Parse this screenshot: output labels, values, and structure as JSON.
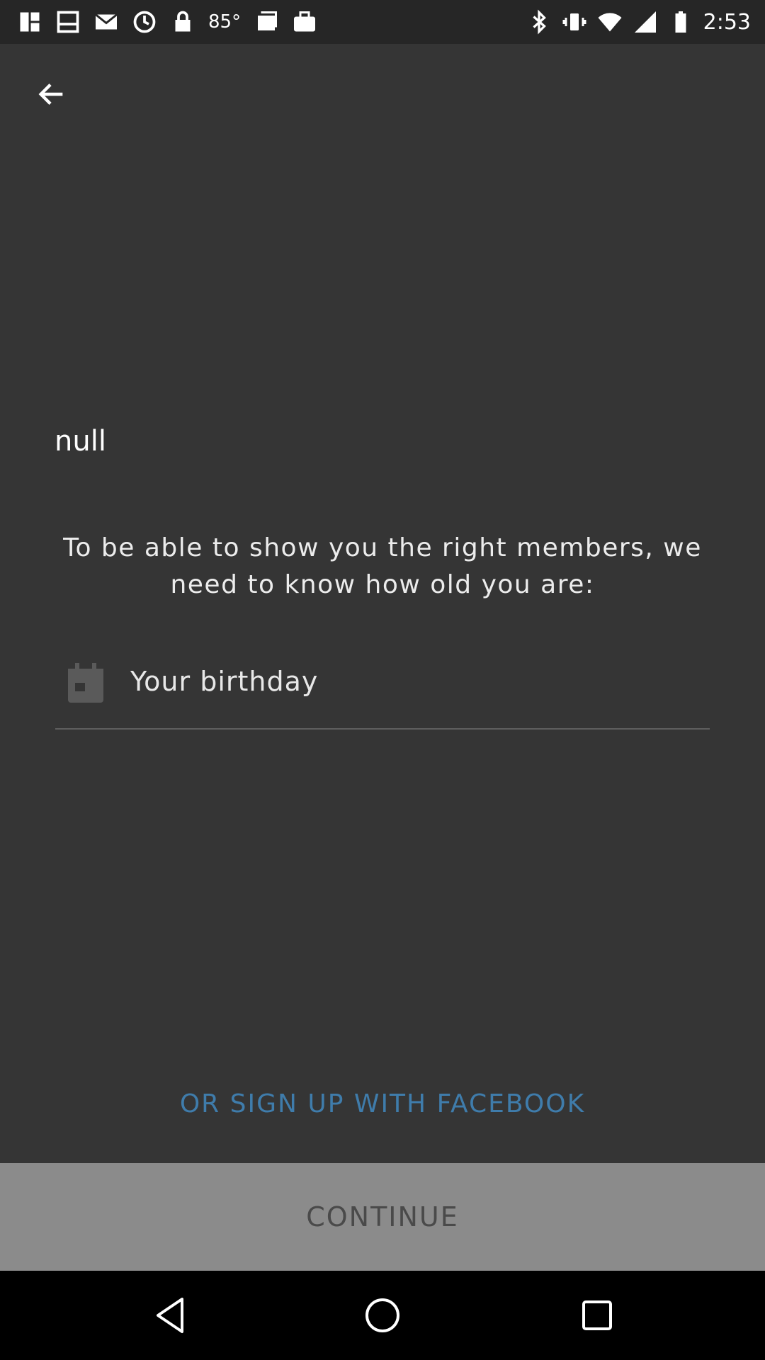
{
  "status_bar": {
    "temperature": "85°",
    "time": "2:53",
    "icons": [
      "notification-icon",
      "notification-icon",
      "mail-icon",
      "sync-icon",
      "lock-icon",
      "temperature-text",
      "gallery-icon",
      "briefcase-icon",
      "bluetooth-icon",
      "vibrate-icon",
      "wifi-icon",
      "signal-icon",
      "battery-icon"
    ]
  },
  "header": {
    "back_icon": "arrow-left-icon"
  },
  "main": {
    "title": "null",
    "info": "To be able to show you the right members, we need to know how old you are:",
    "birthday_placeholder": "Your birthday",
    "birthday_icon": "calendar-icon",
    "facebook_link": "OR SIGN UP WITH FACEBOOK",
    "continue_label": "CONTINUE"
  },
  "colors": {
    "background": "#353535",
    "link": "#3f7cab",
    "button": "#8b8b8b",
    "button_text": "#4a4a4a"
  },
  "nav_bar": {
    "buttons": [
      "back-triangle-icon",
      "home-circle-icon",
      "recents-square-icon"
    ]
  }
}
